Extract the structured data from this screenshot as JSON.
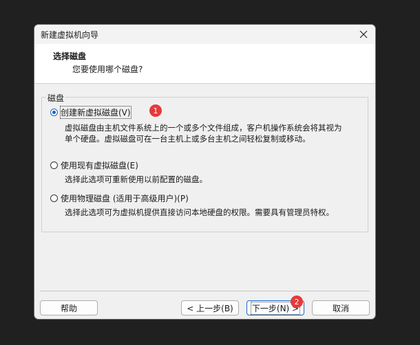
{
  "window": {
    "title": "新建虚拟机向导"
  },
  "header": {
    "title": "选择磁盘",
    "subtitle": "您要使用哪个磁盘?"
  },
  "group": {
    "legend": "磁盘"
  },
  "options": [
    {
      "label": "创建新虚拟磁盘(V)",
      "selected": true,
      "desc_lines": [
        "虚拟磁盘由主机文件系统上的一个或多个文件组成，客户机操作系统会将其视为",
        "单个硬盘。虚拟磁盘可在一台主机上或多台主机之间轻松复制或移动。"
      ]
    },
    {
      "label": "使用现有虚拟磁盘(E)",
      "selected": false,
      "desc_lines": [
        "选择此选项可重新使用以前配置的磁盘。"
      ]
    },
    {
      "label": "使用物理磁盘 (适用于高级用户)(P)",
      "selected": false,
      "desc_lines": [
        "选择此选项可为虚拟机提供直接访问本地硬盘的权限。需要具有管理员特权。"
      ]
    }
  ],
  "buttons": {
    "help": "帮助",
    "back": "< 上一步(B)",
    "next": "下一步(N) >",
    "cancel": "取消"
  },
  "badges": {
    "one": "1",
    "two": "2"
  },
  "colors": {
    "accent": "#1766c7",
    "badge": "#e63a3a"
  }
}
